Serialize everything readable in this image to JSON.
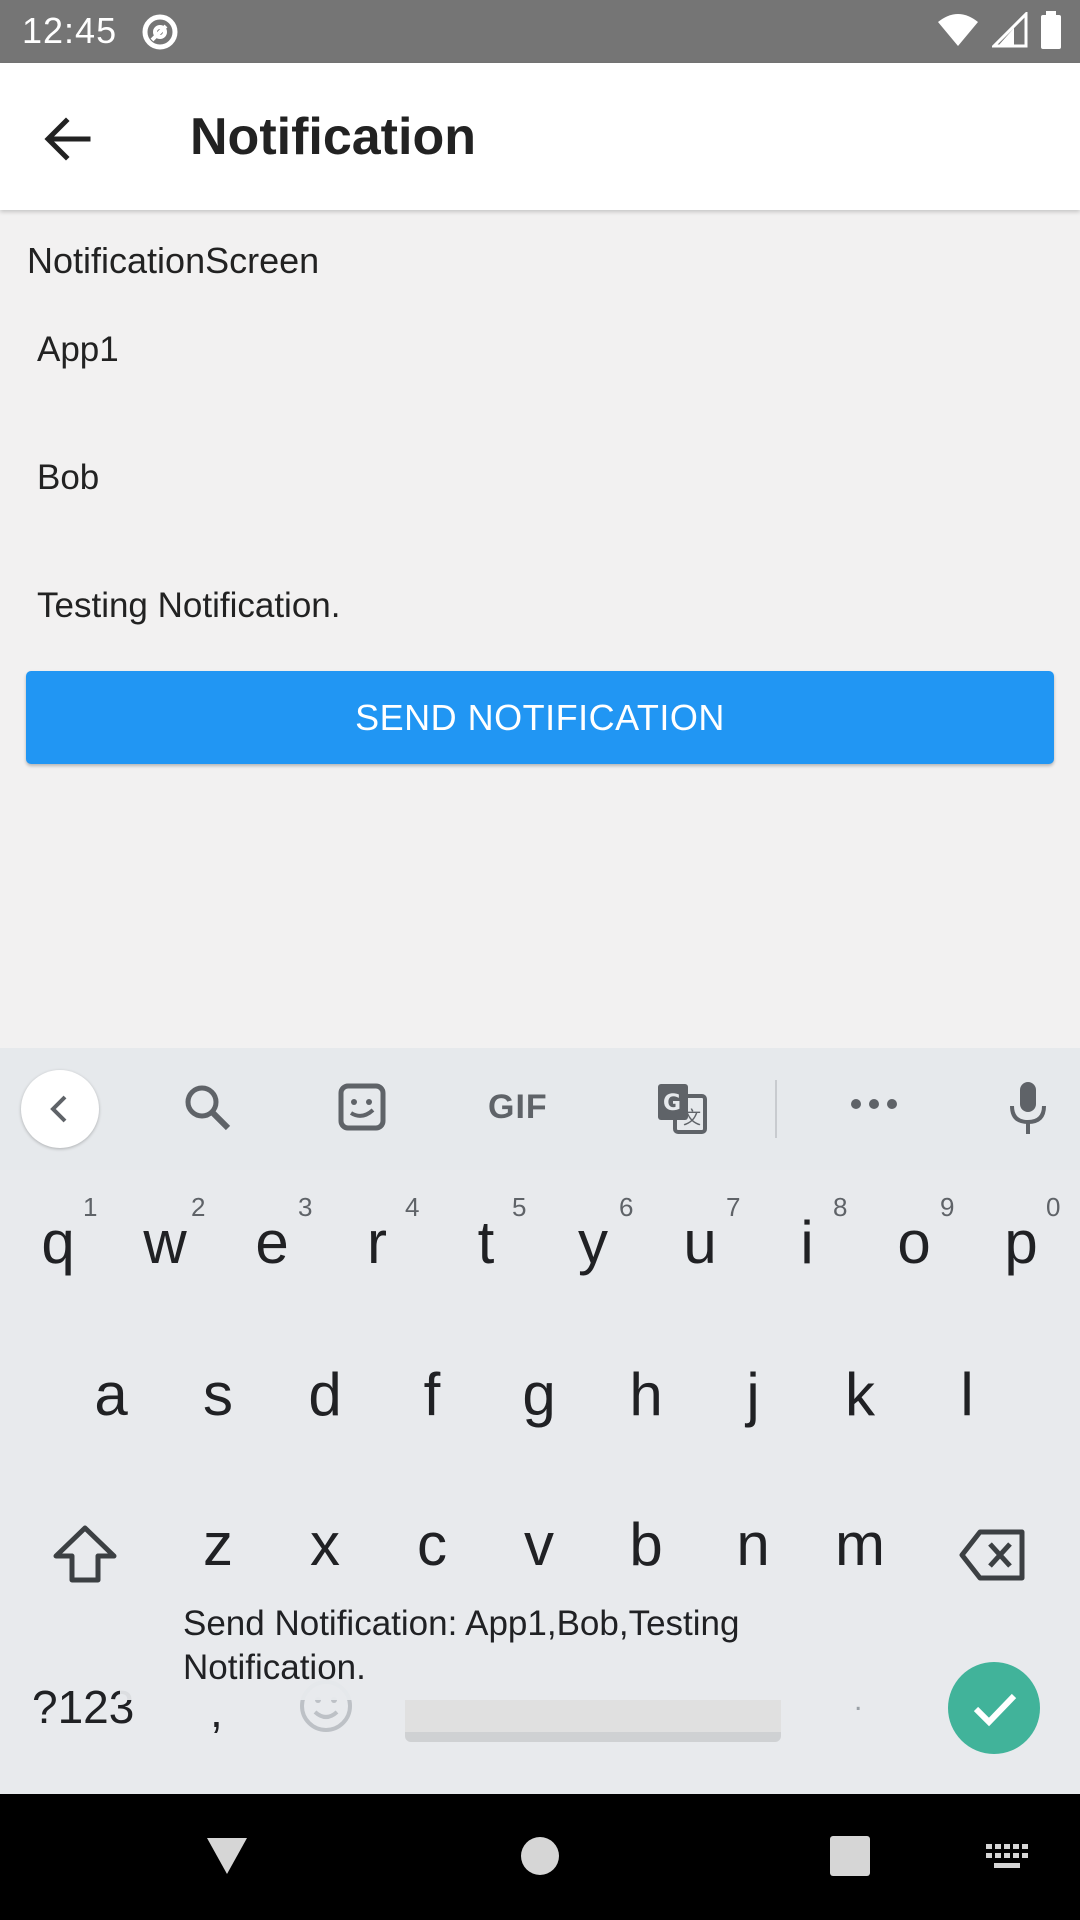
{
  "status_bar": {
    "time": "12:45"
  },
  "app_bar": {
    "title": "Notification"
  },
  "content": {
    "screen_label": "NotificationScreen",
    "fields": [
      "App1",
      "Bob",
      "Testing Notification."
    ],
    "send_button_label": "SEND NOTIFICATION"
  },
  "keyboard": {
    "toolbar": {
      "gif_label": "GIF"
    },
    "row1": [
      {
        "key": "q",
        "hint": "1"
      },
      {
        "key": "w",
        "hint": "2"
      },
      {
        "key": "e",
        "hint": "3"
      },
      {
        "key": "r",
        "hint": "4"
      },
      {
        "key": "t",
        "hint": "5"
      },
      {
        "key": "y",
        "hint": "6"
      },
      {
        "key": "u",
        "hint": "7"
      },
      {
        "key": "i",
        "hint": "8"
      },
      {
        "key": "o",
        "hint": "9"
      },
      {
        "key": "p",
        "hint": "0"
      }
    ],
    "row2": [
      "a",
      "s",
      "d",
      "f",
      "g",
      "h",
      "j",
      "k",
      "l"
    ],
    "row3": [
      "z",
      "x",
      "c",
      "v",
      "b",
      "n",
      "m"
    ],
    "symbols_label": "?123",
    "comma_label": ",",
    "period_label": ".",
    "suggestion": "Send Notification: App1,Bob,Testing Notification."
  }
}
